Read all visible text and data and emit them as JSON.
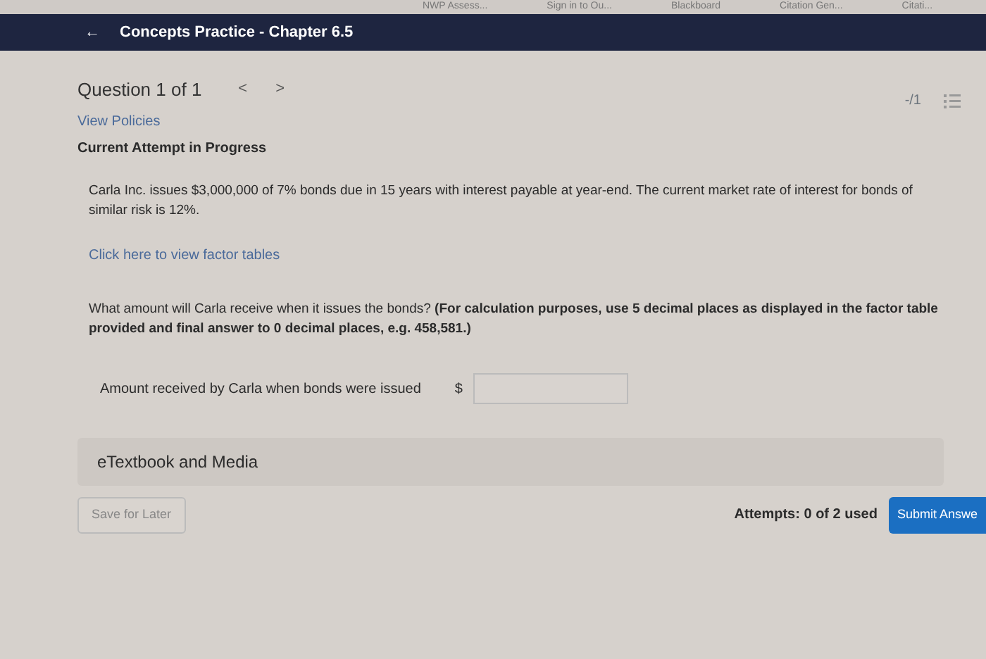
{
  "bookmarks": [
    "NWP Assess...",
    "Sign in to Ou...",
    "Blackboard",
    "Citation Gen...",
    "Citati..."
  ],
  "header": {
    "back_icon": "←",
    "title": "Concepts Practice - Chapter 6.5"
  },
  "question_nav": {
    "title": "Question 1 of 1",
    "prev": "<",
    "next": ">",
    "score": "-/1"
  },
  "view_policies": "View Policies",
  "attempt_status": "Current Attempt in Progress",
  "problem": "Carla Inc. issues $3,000,000 of 7% bonds due in 15 years with interest payable at year-end. The current market rate of interest for bonds of similar risk is 12%.",
  "factor_link": "Click here to view factor tables",
  "question": "What amount will Carla receive when it issues the bonds? **(For calculation purposes, use 5 decimal places as displayed in the factor table provided and final answer to 0 decimal places, e.g. 458,581.)**",
  "answer": {
    "label": "Amount received by Carla when bonds were issued",
    "currency": "$"
  },
  "etextbook": "eTextbook and Media",
  "save_button": "Save for Later",
  "attempts": "Attempts: 0 of 2 used",
  "submit_button": "Submit Answe"
}
